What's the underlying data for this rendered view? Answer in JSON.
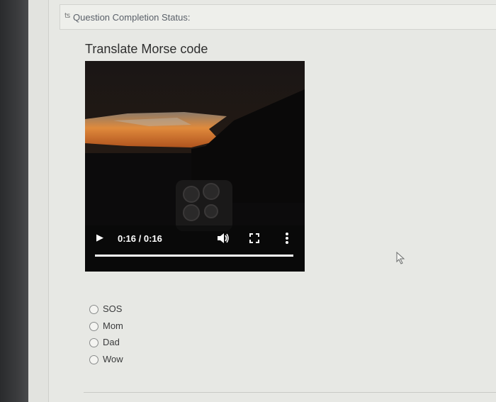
{
  "status": {
    "label": "Question Completion Status:",
    "chevron": "double-chevron-icon"
  },
  "question": {
    "title": "Translate Morse code",
    "video": {
      "time": "0:16 / 0:16",
      "progress": 1.0,
      "icons": {
        "play": "play-icon",
        "volume": "volume-icon",
        "fullscreen": "fullscreen-icon",
        "more": "more-vertical-icon"
      }
    },
    "options": [
      {
        "label": "SOS",
        "selected": false
      },
      {
        "label": "Mom",
        "selected": false
      },
      {
        "label": "Dad",
        "selected": false
      },
      {
        "label": "Wow",
        "selected": false
      }
    ]
  },
  "colors": {
    "page_bg": "#e7e8e4",
    "video_bg": "#0d0c0d",
    "sunset": "#d9742b"
  }
}
